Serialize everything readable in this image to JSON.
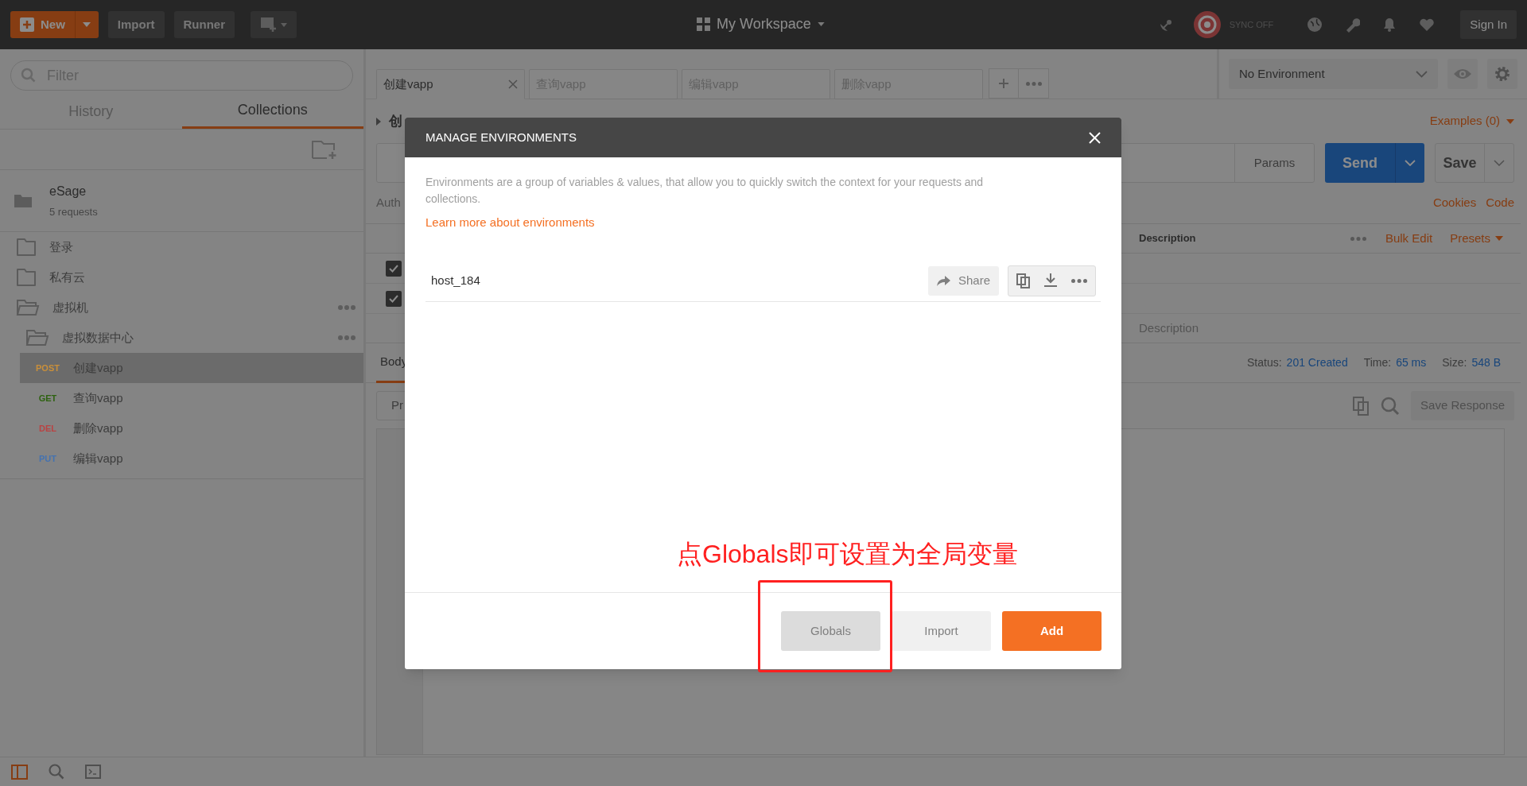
{
  "top_bar": {
    "new_button": "New",
    "buttons": [
      "Import",
      "Runner"
    ],
    "workspace": "My Workspace",
    "sync": "SYNC OFF",
    "sign_in": "Sign In"
  },
  "sidebar": {
    "filter_placeholder": "Filter",
    "tabs": [
      {
        "label": "History",
        "selected": false
      },
      {
        "label": "Collections",
        "selected": true
      }
    ],
    "collection": {
      "name": "eSage",
      "count": "5 requests"
    },
    "items": [
      {
        "kind": "folder",
        "name": "登录",
        "expanded": false,
        "menu": false
      },
      {
        "kind": "folder",
        "name": "私有云",
        "expanded": false,
        "menu": false
      },
      {
        "kind": "folder",
        "name": "虚拟机",
        "expanded": true,
        "menu": true,
        "children": [
          {
            "kind": "folder",
            "name": "虚拟数据中心",
            "expanded": true,
            "menu": true,
            "children": [
              {
                "kind": "request",
                "method": "POST",
                "color": "#c98f3a",
                "name": "创建vapp",
                "selected": true
              },
              {
                "kind": "request",
                "method": "GET",
                "color": "#2e6210",
                "name": "查询vapp",
                "selected": false
              },
              {
                "kind": "request",
                "method": "DEL",
                "color": "#b94343",
                "name": "删除vapp",
                "selected": false
              },
              {
                "kind": "request",
                "method": "PUT",
                "color": "#4472b0",
                "name": "编辑vapp",
                "selected": false
              }
            ]
          }
        ]
      }
    ]
  },
  "request_tabs": [
    {
      "label": "创建vapp",
      "selected": true
    },
    {
      "label": "查询vapp",
      "selected": false
    },
    {
      "label": "编辑vapp",
      "selected": false
    },
    {
      "label": "删除vapp",
      "selected": false
    }
  ],
  "environment": {
    "selected": "No Environment"
  },
  "request": {
    "title": "创",
    "examples": "Examples (0)",
    "params": "Params",
    "send": "Send",
    "save": "Save",
    "tab": "Auth",
    "links": [
      "Cookies",
      "Code"
    ]
  },
  "params_table": {
    "header": "Description",
    "bulk_edit": "Bulk Edit",
    "presets": "Presets",
    "rows": [
      {
        "checked": true
      },
      {
        "checked": true
      }
    ],
    "placeholder": "Description"
  },
  "response": {
    "tab": "Body",
    "status_label": "Status:",
    "status": "201 Created",
    "time_label": "Time:",
    "time": "65 ms",
    "size_label": "Size:",
    "size": "548 B",
    "view_button": "Pr",
    "save_response": "Save Response"
  },
  "modal": {
    "title": "MANAGE ENVIRONMENTS",
    "description": "Environments are a group of variables & values, that allow you to quickly switch the context for your requests and collections.",
    "link": "Learn more about environments",
    "environments": [
      {
        "name": "host_184",
        "share": "Share"
      }
    ],
    "buttons": [
      {
        "label": "Globals",
        "kind": "hover"
      },
      {
        "label": "Import",
        "kind": "plain"
      },
      {
        "label": "Add",
        "kind": "primary"
      }
    ]
  },
  "annotation": {
    "text": "点Globals即可设置为全局变量"
  }
}
